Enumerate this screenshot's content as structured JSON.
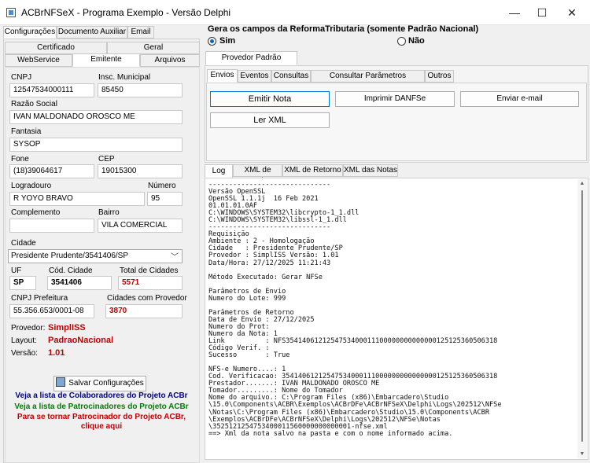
{
  "window": {
    "title": "ACBrNFSeX - Programa Exemplo - Versão Delphi",
    "minimize_glyph": "—",
    "maximize_glyph": "☐",
    "close_glyph": "✕"
  },
  "left": {
    "top_tabs": [
      "Configurações",
      "Documento Auxiliar",
      "Email"
    ],
    "sub_tabs_row1": [
      "Certificado",
      "Geral"
    ],
    "sub_tabs_row2": [
      "WebService",
      "Emitente",
      "Arquivos"
    ],
    "fields": {
      "cnpj_label": "CNPJ",
      "cnpj": "12547534000111",
      "insc_label": "Insc. Municipal",
      "insc": "85450",
      "razao_label": "Razão Social",
      "razao": "IVAN MALDONADO OROSCO ME",
      "fantasia_label": "Fantasia",
      "fantasia": "SYSOP",
      "fone_label": "Fone",
      "fone": "(18)39064617",
      "cep_label": "CEP",
      "cep": "19015300",
      "logradouro_label": "Logradouro",
      "logradouro": "R YOYO BRAVO",
      "numero_label": "Número",
      "numero": "95",
      "complemento_label": "Complemento",
      "complemento": "",
      "bairro_label": "Bairro",
      "bairro": "VILA COMERCIAL",
      "cidade_label": "Cidade",
      "cidade": "Presidente Prudente/3541406/SP",
      "uf_label": "UF",
      "uf": "SP",
      "cod_cidade_label": "Cód. Cidade",
      "cod_cidade": "3541406",
      "total_cidades_label": "Total de Cidades",
      "total_cidades": "5571",
      "cnpj_pref_label": "CNPJ Prefeitura",
      "cnpj_pref": "55.356.653/0001-08",
      "cidades_prov_label": "Cidades com Provedor",
      "cidades_prov": "3870"
    },
    "info": {
      "provedor_label": "Provedor:",
      "provedor": "SimplISS",
      "layout_label": "Layout:",
      "layout": "PadraoNacional",
      "versao_label": "Versão:",
      "versao": "1.01"
    },
    "save_button": "Salvar Configurações",
    "links": {
      "colaboradores": "Veja a lista de Colaboradores do Projeto ACBr",
      "patrocinadores": "Veja a lista de Patrocinadores do Projeto ACBr",
      "patrocinador_line1": "Para se tornar Patrocinador do Projeto ACBr,",
      "patrocinador_line2": "clique aqui"
    },
    "colors": {
      "blue": "#00008b",
      "green": "#008000",
      "red": "#c00000"
    }
  },
  "right": {
    "group_title": "Gera os campos da ReformaTributaria (somente Padrão Nacional)",
    "radio_sim": "Sim",
    "radio_nao": "Não",
    "provider_tab": "Provedor Padrão Nacional",
    "action_tabs": [
      "Envios",
      "Eventos",
      "Consultas",
      "Consultar Parâmetros Municipais",
      "Outros"
    ],
    "buttons": {
      "emitir": "Emitir Nota",
      "imprimir": "Imprimir DANFSe",
      "email": "Enviar e-mail",
      "ler_xml": "Ler XML"
    },
    "log_tabs": [
      "Log",
      "XML de Envio",
      "XML de Retorno",
      "XML das Notas"
    ],
    "log_text": "------------------------------\nVersão OpenSSL\nOpenSSL 1.1.1j  16 Feb 2021\n01.01.01.0AF\nC:\\WINDOWS\\SYSTEM32\\libcrypto-1_1.dll\nC:\\WINDOWS\\SYSTEM32\\libssl-1_1.dll\n------------------------------\nRequisição\nAmbiente : 2 - Homologação\nCidade   : Presidente Prudente/SP\nProvedor : SimplISS Versão: 1.01\nData/Hora: 27/12/2025 11:21:43\n\nMétodo Executado: Gerar NFSe\n\nParâmetros de Envio\nNumero do Lote: 999\n\nParâmetros de Retorno\nData de Envio : 27/12/2025\nNumero do Prot:\nNumero da Nota: 1\nLink          : NFS3541406121254753400011100000000000000125125360506318\nCódigo Verif. :\nSucesso       : True\n\nNFS-e Numero....: 1\nCod. Verificacao: 35414061212547534000111000000000000000125125360506318\nPrestador.......: IVAN MALDONADO OROSCO ME\nTomador.........: Nome do Tomador\nNome do arquivo.: C:\\Program Files (x86)\\Embarcadero\\Studio\n\\15.0\\Components\\ACBR\\Exemplos\\ACBrDFe\\ACBrNFSeX\\Delphi\\Logs\\202512\\NFSe\n\\Notas\\C:\\Program Files (x86)\\Embarcadero\\Studio\\15.0\\Components\\ACBR\n\\Exemplos\\ACBrDFe\\ACBrNFSeX\\Delphi\\Logs\\202512\\NFSe\\Notas\n\\3525121254753400011560000000000001-nfse.xml\n==> Xml da nota salvo na pasta e com o nome informado acima."
  }
}
